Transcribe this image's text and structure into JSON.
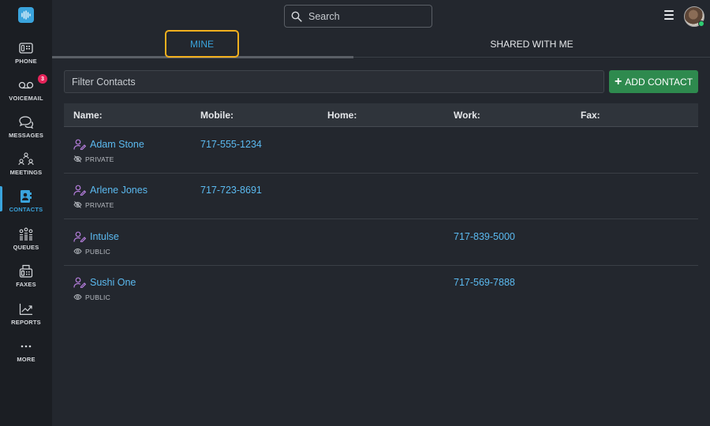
{
  "sidebar": {
    "logo": "soundwave-logo-icon",
    "items": [
      {
        "label": "PHONE",
        "icon": "phone-icon"
      },
      {
        "label": "VOICEMAIL",
        "icon": "voicemail-icon",
        "badge": "3"
      },
      {
        "label": "MESSAGES",
        "icon": "messages-icon"
      },
      {
        "label": "MEETINGS",
        "icon": "meetings-icon"
      },
      {
        "label": "CONTACTS",
        "icon": "contacts-icon",
        "active": true
      },
      {
        "label": "QUEUES",
        "icon": "queues-icon"
      },
      {
        "label": "FAXES",
        "icon": "fax-icon"
      },
      {
        "label": "REPORTS",
        "icon": "reports-icon"
      },
      {
        "label": "MORE",
        "icon": "more-icon"
      }
    ]
  },
  "header": {
    "search_placeholder": "Search"
  },
  "tabs": [
    {
      "label": "MINE",
      "active": true
    },
    {
      "label": "SHARED WITH ME",
      "active": false
    }
  ],
  "filter": {
    "placeholder": "Filter Contacts"
  },
  "add_button": {
    "label": "ADD CONTACT"
  },
  "table": {
    "columns": [
      "Name:",
      "Mobile:",
      "Home:",
      "Work:",
      "Fax:"
    ],
    "rows": [
      {
        "name": "Adam Stone",
        "visibility": "PRIVATE",
        "mobile": "717-555-1234",
        "home": "",
        "work": "",
        "fax": ""
      },
      {
        "name": "Arlene Jones",
        "visibility": "PRIVATE",
        "mobile": "717-723-8691",
        "home": "",
        "work": "",
        "fax": ""
      },
      {
        "name": "Intulse",
        "visibility": "PUBLIC",
        "mobile": "",
        "home": "",
        "work": "717-839-5000",
        "fax": ""
      },
      {
        "name": "Sushi One",
        "visibility": "PUBLIC",
        "mobile": "",
        "home": "",
        "work": "717-569-7888",
        "fax": ""
      }
    ]
  },
  "colors": {
    "accent": "#3aa4dd",
    "link": "#5bbaf0",
    "add_button": "#2e8a4e",
    "badge": "#e6245a",
    "tab_highlight": "#f2b01e",
    "person_icon": "#b57edc"
  }
}
